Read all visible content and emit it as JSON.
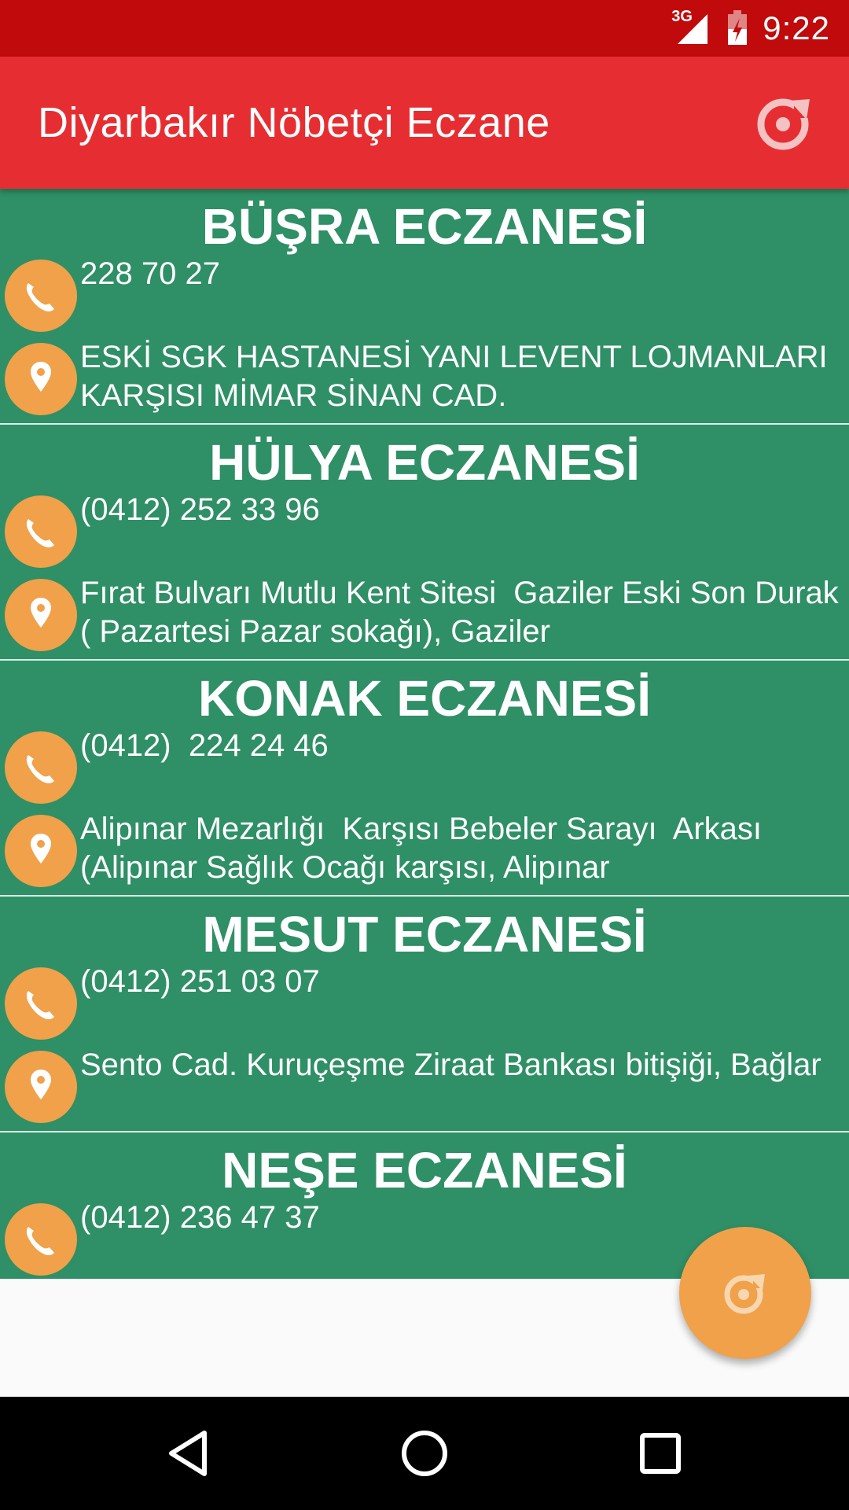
{
  "status_bar": {
    "network": "3G",
    "time": "9:22",
    "colors": {
      "background": "#c00a0c"
    }
  },
  "app_bar": {
    "title": "Diyarbakır Nöbetçi Eczane",
    "refresh_icon": "refresh-icon",
    "colors": {
      "background": "#e62e32"
    }
  },
  "pharmacies": [
    {
      "name": "BÜŞRA ECZANESİ",
      "phone": "228 70 27",
      "address": "ESKİ SGK HASTANESİ YANI LEVENT LOJMANLARI KARŞISI MİMAR SİNAN CAD."
    },
    {
      "name": "HÜLYA ECZANESİ",
      "phone": "(0412) 252 33 96",
      "address": "Fırat Bulvarı Mutlu Kent Sitesi  Gaziler Eski Son Durak ( Pazartesi Pazar sokağı), Gaziler"
    },
    {
      "name": "KONAK ECZANESİ",
      "phone": "(0412)  224 24 46",
      "address": "Alipınar Mezarlığı  Karşısı Bebeler Sarayı  Arkası (Alipınar Sağlık Ocağı karşısı, Alipınar"
    },
    {
      "name": "MESUT ECZANESİ",
      "phone": "(0412) 251 03 07",
      "address": "Sento Cad. Kuruçeşme Ziraat Bankası bitişiği, Bağlar"
    },
    {
      "name": "NEŞE ECZANESİ",
      "phone": "(0412) 236 47 37",
      "address": ""
    }
  ],
  "icons": {
    "phone": "phone-icon",
    "location": "location-pin-icon",
    "fab": "refresh-icon"
  },
  "colors": {
    "list_background": "#2f8f66",
    "accent": "#f0a14a",
    "divider": "#d9efe5"
  },
  "nav_bar": {
    "buttons": [
      "back-icon",
      "home-icon",
      "recents-icon"
    ]
  }
}
